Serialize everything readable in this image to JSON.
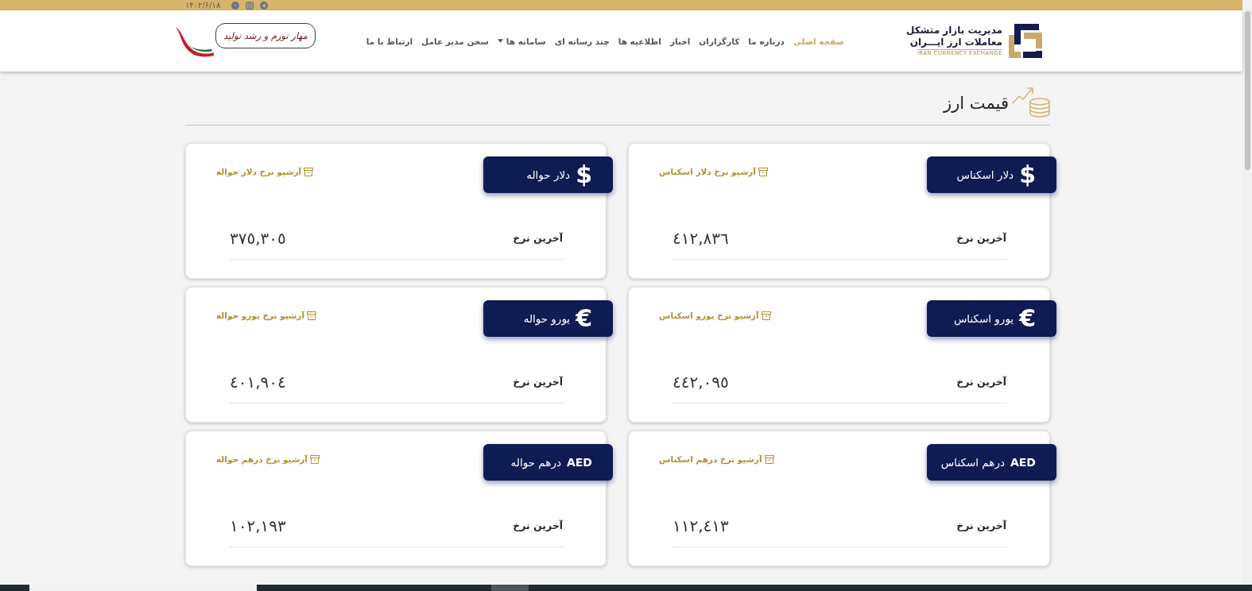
{
  "top_bar": {
    "date": "۱۴۰۲/۶/۱۸"
  },
  "header": {
    "logo": {
      "line_1": "مدیریت بازار متشکل",
      "line_2": "معاملات ارز ایـــران",
      "subtitle": "IRAN CURRENCY EXCHANGE"
    },
    "nav": [
      {
        "label": "صفحه اصلی",
        "selected": true,
        "dropdown": false
      },
      {
        "label": "درباره ما",
        "selected": false,
        "dropdown": false
      },
      {
        "label": "کارگزاران",
        "selected": false,
        "dropdown": false
      },
      {
        "label": "اخبار",
        "selected": false,
        "dropdown": false
      },
      {
        "label": "اطلاعیه ها",
        "selected": false,
        "dropdown": false
      },
      {
        "label": "چند رسانه ای",
        "selected": false,
        "dropdown": false
      },
      {
        "label": "سامانه ها",
        "selected": false,
        "dropdown": true
      },
      {
        "label": "سخن مدیر عامل",
        "selected": false,
        "dropdown": false
      },
      {
        "label": "ارتباط با ما",
        "selected": false,
        "dropdown": false
      }
    ],
    "slogan": "مهار تورم و رشد تولید"
  },
  "section": {
    "title": "قیمت ارز"
  },
  "cards": [
    {
      "kind": "sign",
      "symbol": "$",
      "title": "دلار اسکناس",
      "archive_link": "آرشیو نرخ دلار اسکناس",
      "rate_label": "آخرین نرخ",
      "rate": "٤١٢,٨٣٦"
    },
    {
      "kind": "sign",
      "symbol": "$",
      "title": "دلار حواله",
      "archive_link": "آرشیو نرخ دلار حواله",
      "rate_label": "آخرین نرخ",
      "rate": "٣٧٥,٣٠٥"
    },
    {
      "kind": "sign",
      "symbol": "€",
      "title": "یورو اسکناس",
      "archive_link": "آرشیو نرخ یورو اسکناس",
      "rate_label": "آخرین نرخ",
      "rate": "٤٤٢,٠٩٥"
    },
    {
      "kind": "sign",
      "symbol": "€",
      "title": "یورو حواله",
      "archive_link": "آرشیو نرخ یورو حواله",
      "rate_label": "آخرین نرخ",
      "rate": "٤٠١,٩٠٤"
    },
    {
      "kind": "code",
      "symbol": "AED",
      "title": "درهم اسکناس",
      "archive_link": "آرشیو نرخ درهم اسکناس",
      "rate_label": "آخرین نرخ",
      "rate": "١١٢,٤١٣"
    },
    {
      "kind": "code",
      "symbol": "AED",
      "title": "درهم حواله",
      "archive_link": "آرشیو نرخ درهم حواله",
      "rate_label": "آخرین نرخ",
      "rate": "١٠٢,١٩٣"
    }
  ]
}
